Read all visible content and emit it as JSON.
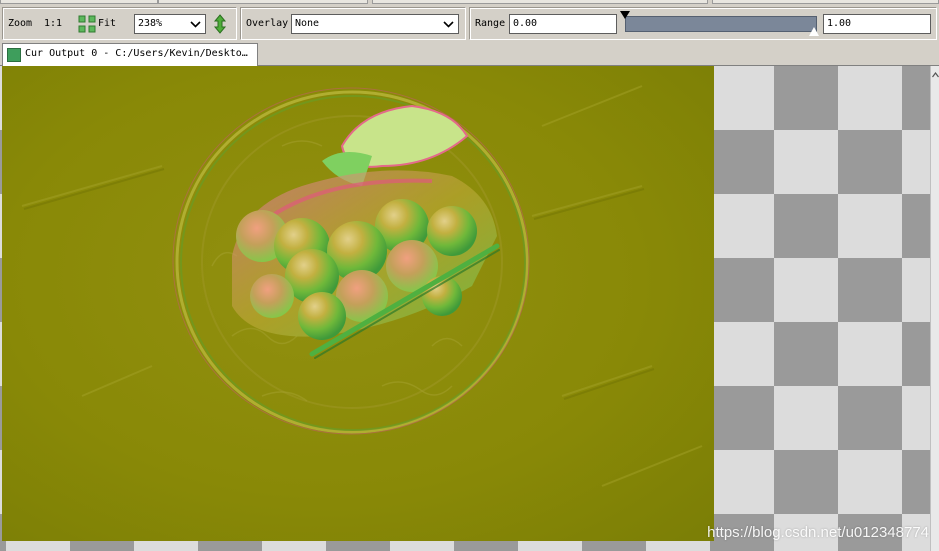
{
  "toolbar": {
    "zoom_label": "Zoom",
    "zoom_1to1_label": "1:1",
    "fit_label": "Fit",
    "zoom_value": "238%",
    "overlay_label": "Overlay",
    "overlay_value": "None",
    "range_label": "Range",
    "range_min": "0.00",
    "range_max": "1.00"
  },
  "tab": {
    "title": "Cur Output 0 - C:/Users/Kevin/Deskto…"
  },
  "icons": {
    "fit": "fit-to-window-icon",
    "swap": "swap-arrows-icon",
    "dropdown": "chevron-down-icon",
    "tab": "texture-viewer-icon",
    "scroll_up": "scroll-up-arrow-icon"
  },
  "colors": {
    "texture_base": "#888a0a",
    "checker_light": "#dcdcdc",
    "checker_dark": "#9a9a9a",
    "range_track": "#7b8799"
  },
  "watermark": "https://blog.csdn.net/u012348774"
}
